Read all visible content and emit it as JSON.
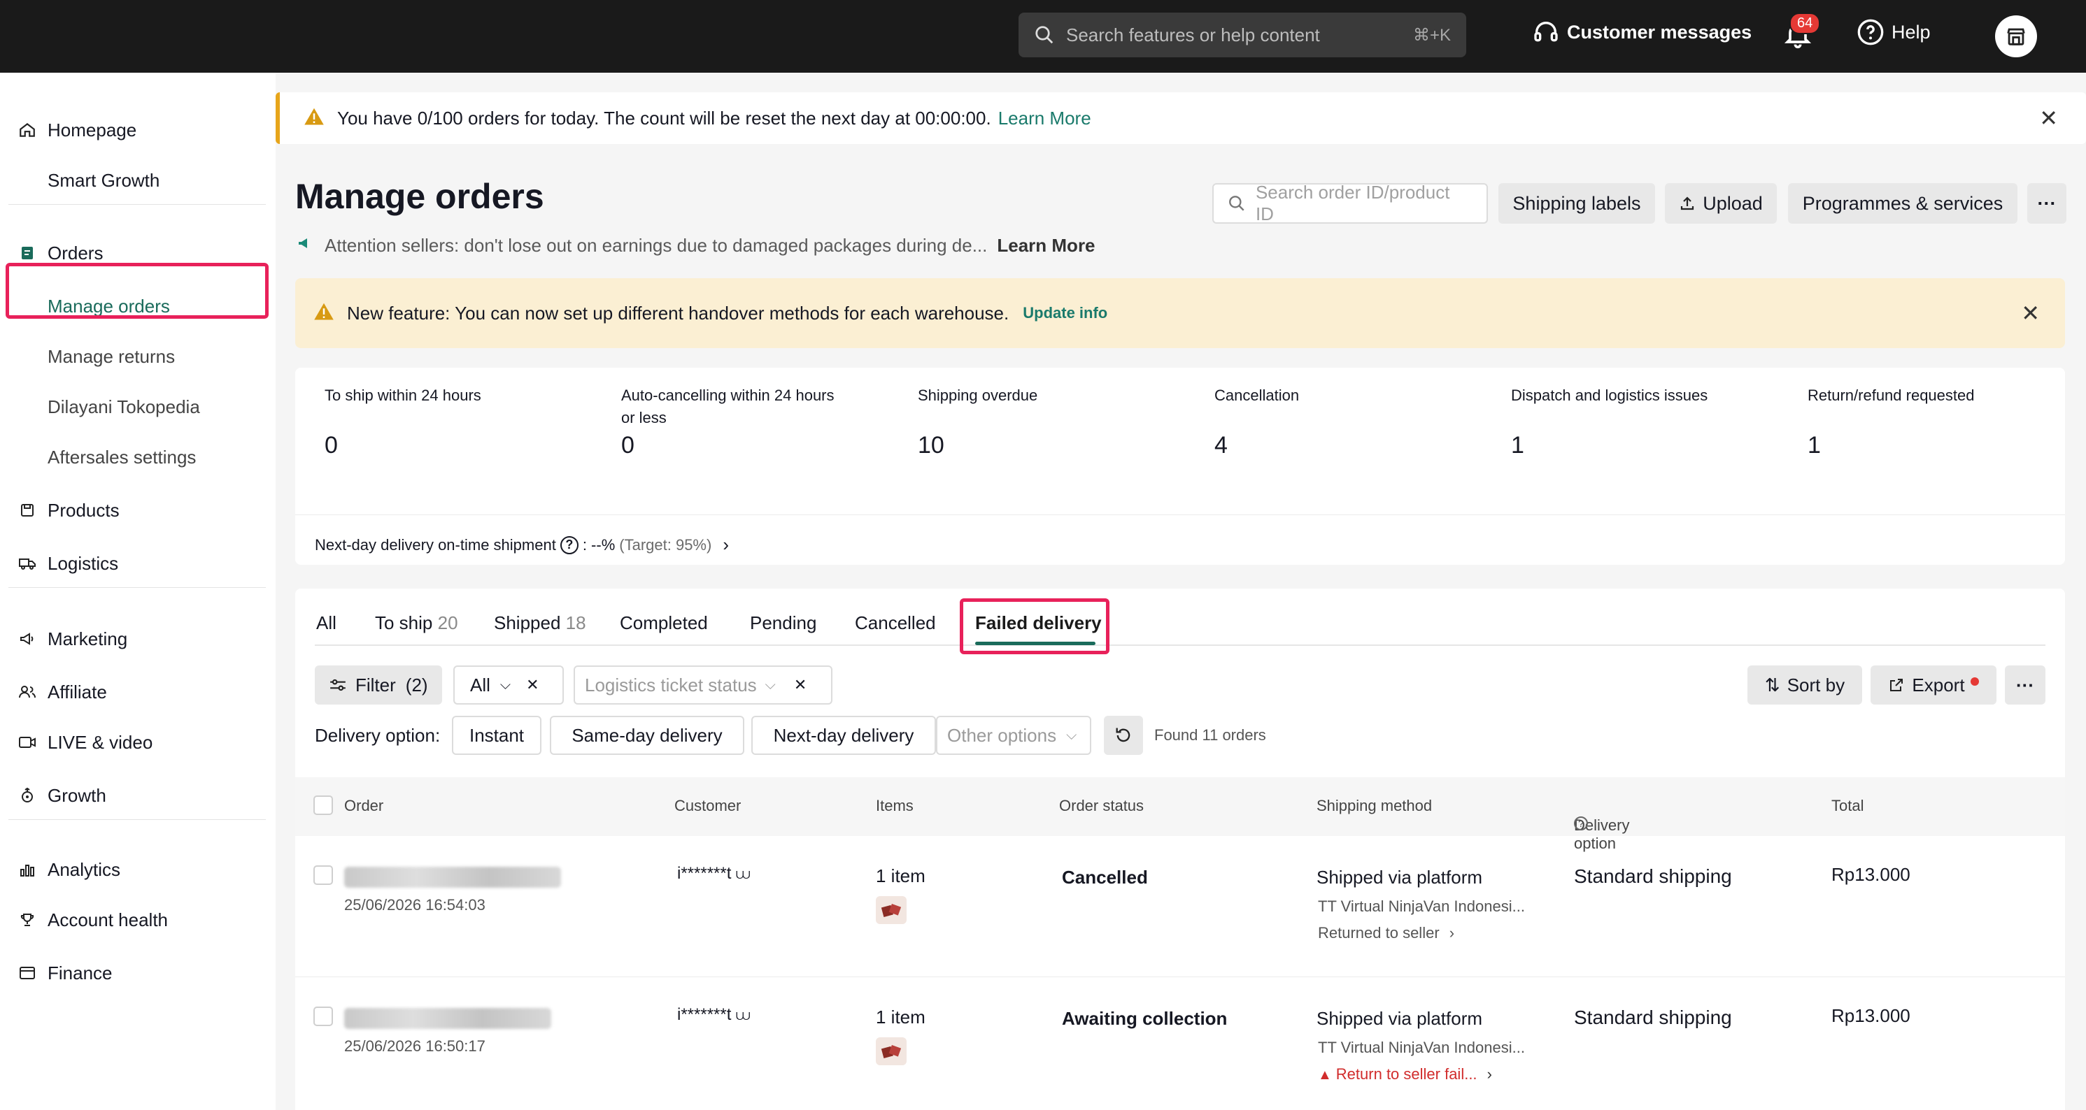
{
  "topbar": {
    "search_placeholder": "Search features or help content",
    "search_shortcut": "⌘+K",
    "customer_messages": "Customer messages",
    "notifications_count": "64",
    "help": "Help"
  },
  "sidebar": {
    "homepage": "Homepage",
    "smart_growth": "Smart Growth",
    "orders": "Orders",
    "manage_orders": "Manage orders",
    "manage_returns": "Manage returns",
    "dilayani_tokopedia": "Dilayani Tokopedia",
    "aftersales_settings": "Aftersales settings",
    "products": "Products",
    "logistics": "Logistics",
    "marketing": "Marketing",
    "affiliate": "Affiliate",
    "live_video": "LIVE & video",
    "growth": "Growth",
    "analytics": "Analytics",
    "account_health": "Account health",
    "finance": "Finance"
  },
  "alert": {
    "text": "You have 0/100 orders for today. The count will be reset the next day at 00:00:00.",
    "link": "Learn More"
  },
  "header": {
    "title": "Manage orders",
    "attention": "Attention sellers: don't lose out on earnings due to damaged packages during de...",
    "attention_link": "Learn More",
    "search_placeholder": "Search order ID/product ID",
    "shipping_labels": "Shipping labels",
    "upload": "Upload",
    "programmes": "Programmes & services",
    "more": "···"
  },
  "feature_banner": {
    "text": "New feature: You can now set up different handover methods for each warehouse.",
    "link": "Update info"
  },
  "stats": [
    {
      "label": "To ship within 24 hours",
      "value": "0"
    },
    {
      "label": "Auto-cancelling within 24 hours or less",
      "value": "0"
    },
    {
      "label": "Shipping overdue",
      "value": "10"
    },
    {
      "label": "Cancellation",
      "value": "4"
    },
    {
      "label": "Dispatch and logistics issues",
      "value": "1"
    },
    {
      "label": "Return/refund requested",
      "value": "1"
    }
  ],
  "ontime": {
    "label": "Next-day delivery on-time shipment",
    "value": ": --%",
    "target": "(Target: 95%)"
  },
  "tabs": [
    {
      "label": "All",
      "count": ""
    },
    {
      "label": "To ship",
      "count": "20"
    },
    {
      "label": "Shipped",
      "count": "18"
    },
    {
      "label": "Completed",
      "count": ""
    },
    {
      "label": "Pending",
      "count": ""
    },
    {
      "label": "Cancelled",
      "count": ""
    },
    {
      "label": "Failed delivery",
      "count": ""
    }
  ],
  "filters": {
    "filter": "Filter",
    "filter_count": "(2)",
    "all": "All",
    "logistics_placeholder": "Logistics ticket status",
    "sort_by": "Sort by",
    "export": "Export",
    "more": "···",
    "delivery_option_label": "Delivery option:",
    "instant": "Instant",
    "same_day": "Same-day delivery",
    "next_day": "Next-day delivery",
    "other_options": "Other options",
    "found": "Found 11 orders"
  },
  "table": {
    "headers": {
      "order": "Order",
      "customer": "Customer",
      "items": "Items",
      "order_status": "Order status",
      "shipping_method": "Shipping method",
      "delivery_option": "Delivery option",
      "total": "Total"
    },
    "rows": [
      {
        "date": "25/06/2026 16:54:03",
        "customer": "i*******t",
        "items": "1 item",
        "status": "Cancelled",
        "shipping": "Shipped via platform",
        "carrier": "TT Virtual NinjaVan Indonesi...",
        "note": "Returned to seller",
        "delivery": "Standard shipping",
        "total": "Rp13.000"
      },
      {
        "date": "25/06/2026 16:50:17",
        "customer": "i*******t",
        "items": "1 item",
        "status": "Awaiting collection",
        "shipping": "Shipped via platform",
        "carrier": "TT Virtual NinjaVan Indonesi...",
        "note": "Return to seller fail...",
        "delivery": "Standard shipping",
        "total": "Rp13.000"
      }
    ]
  }
}
